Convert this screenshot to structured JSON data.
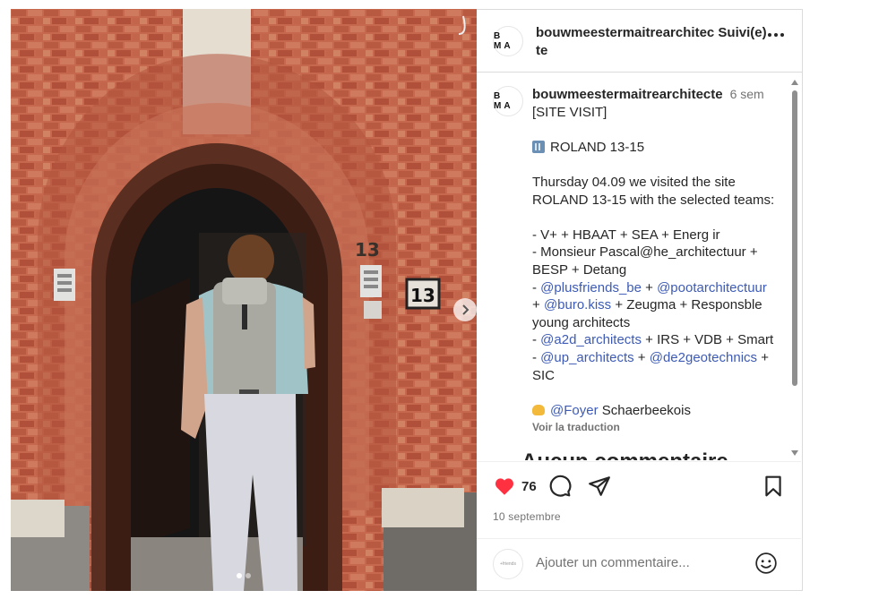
{
  "post": {
    "photo_alt": "Photo",
    "carousel": {
      "current": 1,
      "total": 2
    }
  },
  "header": {
    "avatar_text": "B MA",
    "username": "bouwmeestermaitrearchitec",
    "follow_state": "Suivi(e)",
    "follow_tail": "te"
  },
  "caption": {
    "avatar_text": "B MA",
    "username": "bouwmeestermaitrearchitecte",
    "time": "6 sem",
    "line1": "[SITE VISIT]",
    "line2": "ROLAND 13-15",
    "line3": "Thursday 04.09 we visited the site",
    "line4": "ROLAND 13-15 with the selected teams:",
    "line5": "- V+ + HBAAT + SEA + Energ ir",
    "line6": "- Monsieur Pascal@he_architectuur +",
    "line7": "BESP + Detang",
    "line8_pre": "- ",
    "line8_m1": "@plusfriends_be",
    "line8_mid": " + ",
    "line8_m2": "@pootarchitectuur",
    "line9_pre": "+ ",
    "line9_m1": "@buro.kiss",
    "line9_post": " + Zeugma + Responsble",
    "line10": "young architects",
    "line11_pre": "- ",
    "line11_m1": "@a2d_architects",
    "line11_post": " + IRS + VDB + Smart",
    "line12_pre": "- ",
    "line12_m1": "@up_architects",
    "line12_mid": " + ",
    "line12_m2": "@de2geotechnics",
    "line12_post": " +",
    "line13": "SIC",
    "line14_m1": "@Foyer",
    "line14_post": " Schaerbeekois",
    "see_translation": "Voir la traduction"
  },
  "comments": {
    "empty_title": "Aucun commentaire"
  },
  "actions": {
    "likes": "76",
    "date": "10 septembre",
    "like_color": "#ff3040"
  },
  "add_comment": {
    "avatar_text": "+friends",
    "placeholder": "Ajouter un commentaire..."
  },
  "photo_details": {
    "door_number": "13"
  }
}
